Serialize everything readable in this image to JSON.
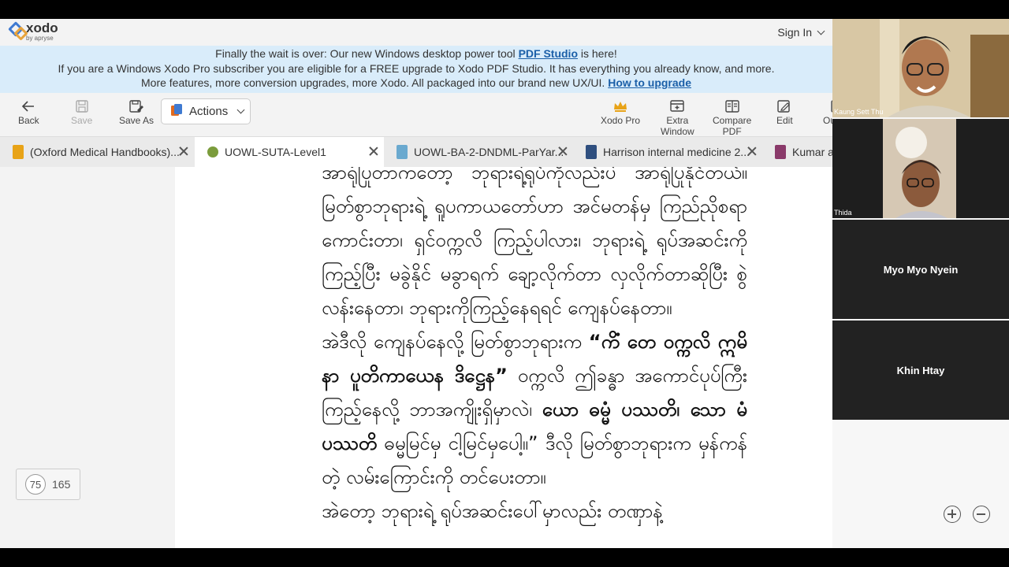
{
  "app": {
    "logo_name": "xodo",
    "logo_sub": "by apryse",
    "sign_in": "Sign In"
  },
  "banner": {
    "line1_a": "Finally the wait is over: Our new Windows desktop power tool ",
    "line1_link": "PDF Studio",
    "line1_b": " is here!",
    "line2": "If you are a Windows Xodo Pro subscriber you are eligible for a FREE upgrade to Xodo PDF Studio. It has everything you already know, and more.",
    "line3_a": "More features, more conversion upgrades, more Xodo. All packaged into our brand new UX/UI. ",
    "line3_link": "How to upgrade"
  },
  "toolbar": {
    "back": "Back",
    "save": "Save",
    "save_as": "Save As",
    "actions": "Actions",
    "xodo_pro": "Xodo Pro",
    "extra_window_1": "Extra",
    "extra_window_2": "Window",
    "compare_1": "Compare",
    "compare_2": "PDF",
    "edit": "Edit",
    "outline": "Outline"
  },
  "tabs": [
    {
      "label": "(Oxford Medical Handbooks)..."
    },
    {
      "label": "UOWL-SUTA-Level1"
    },
    {
      "label": "UOWL-BA-2-DNDML-ParYar..."
    },
    {
      "label": "Harrison internal medicine 2..."
    },
    {
      "label": "Kumar an"
    }
  ],
  "document": {
    "p1": "အာရုံပြုတာကတော့ ဘုရားရဲ့ရုပ်ကိုလည်းပဲ အာရုံပြုနိုင်တယ်။ မြတ်စွာဘုရားရဲ့ ရူပကာယတော်ဟာ အင်မတန်မှ ကြည်ညိုစရာကောင်းတာ၊ ရှင်ဝက္ကလိ ကြည့်ပါလား၊ ဘုရားရဲ့ ရုပ်အဆင်းကို ကြည့်ပြီး မခွဲနိုင် မခွာရက် ချော့လိုက်တာ လှလိုက်တာဆိုပြီး စွဲလန်းနေတာ၊ ဘုရားကိုကြည့်နေရရင် ကျေနပ်နေတာ။",
    "p2a": "အဲဒီလို ကျေနပ်နေလို့ မြတ်စွာဘုရားက ",
    "p2b": "“ကိံ တေ ဝက္ကလိ ဣမိနာ ပူတိကာယေန ဒိဋ္ဌေန”",
    "p2c": " ဝက္ကလိ ဤခန္ဓာ အကောင်ပုပ်ကြီး ကြည့်နေလို့ ဘာအကျိုးရှိမှာလဲ၊ ",
    "p2d": "ယော ဓမ္မံ ပဿတိ၊ သော မံ ပဿတိ",
    "p2e": " ဓမ္မမြင်မှ ငါ့မြင်မှပေါ့။” ဒီလို မြတ်စွာဘုရားက မှန်ကန်တဲ့ လမ်းကြောင်းကို တင်ပေးတာ။",
    "p3": "အဲတော့ ဘုရားရဲ့ ရုပ်အဆင်းပေါ်မှာလည်း တဏှာနဲ့"
  },
  "page_indicator": {
    "current": "75",
    "total": "165"
  },
  "participants": [
    {
      "name": "Kaung Sett Thu"
    },
    {
      "name": "Thida"
    },
    {
      "name": "Myo Myo Nyein"
    },
    {
      "name": "Khin Htay"
    }
  ],
  "colors": {
    "banner_bg": "#d9ecfa",
    "link": "#1b5fa8",
    "pro_gold": "#e8a317"
  }
}
